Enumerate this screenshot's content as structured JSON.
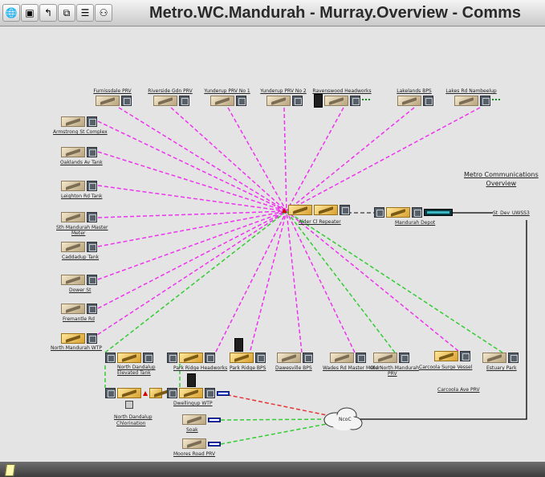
{
  "title": "Metro.WC.Mandurah - Murray.Overview - Comms",
  "toolbar": {
    "buttons": [
      {
        "icon": "globe-icon",
        "glyph": "🌐"
      },
      {
        "icon": "document-icon",
        "glyph": "▣"
      },
      {
        "icon": "up-arrow-icon",
        "glyph": "↰"
      },
      {
        "icon": "copy-icon",
        "glyph": "⧉"
      },
      {
        "icon": "list-icon",
        "glyph": "☰"
      },
      {
        "icon": "binoculars-icon",
        "glyph": "⚇"
      }
    ]
  },
  "overview_title": {
    "line1": "Metro Communications",
    "line2": "Overview"
  },
  "colors": {
    "radio_link": "#ee33ee",
    "alt_link": "#33cc33",
    "fault_link": "#e53333",
    "wired": "#000000"
  },
  "labels": {
    "furnissdale": "Furnissdale PRV",
    "riverside": "Riverside Gdn PRV",
    "yunderup1": "Yunderup PRV No 1",
    "yunderup2": "Yunderup PRV No 2",
    "ravenswood": "Ravenswood Headworks",
    "lakelands": "Lakelands BPS",
    "lakes_rd": "Lakes Rd Nambeelup",
    "armstrong": "Armstrong St Complex",
    "oaklands": "Oaklands Av Tank",
    "leighton": "Leighton Rd Tank",
    "sth_mandurah_1": "Sth Mandurah Master",
    "sth_mandurah_2": "Meter",
    "caddadup": "Caddadup Tank",
    "dower": "Dower St",
    "fremantle": "Fremantle Rd",
    "north_mandurah_wtp": "North Mandurah WTP",
    "alder": "Alder Cl Repeater",
    "mandurah_depot": "Mandurah Depot",
    "st_dev": "St_Dev_UWSS3",
    "north_dandalup_tank_1": "North Dandalup",
    "north_dandalup_tank_2": "Elevated Tank",
    "park_ridge_hw": "Park Ridge Headworks",
    "park_ridge_bps": "Park Ridge BPS",
    "dawesville": "Dawesville BPS",
    "wades": "Wades Rd Master Meter",
    "old_north_1": "Old North Mandurah",
    "old_north_2": "PRV",
    "carcoola_surge": "Carcoola Surge Vessel",
    "carcoola_ave": "Carcoola Ave PRV",
    "estuary": "Estuary Park",
    "north_dandalup_chl_1": "North Dandalup",
    "north_dandalup_chl_2": "Chlorination",
    "dwellingup": "Dwellingup WTP",
    "soak": "Soak",
    "moores": "Moores Road PRV",
    "ncoc": "NcoC"
  }
}
